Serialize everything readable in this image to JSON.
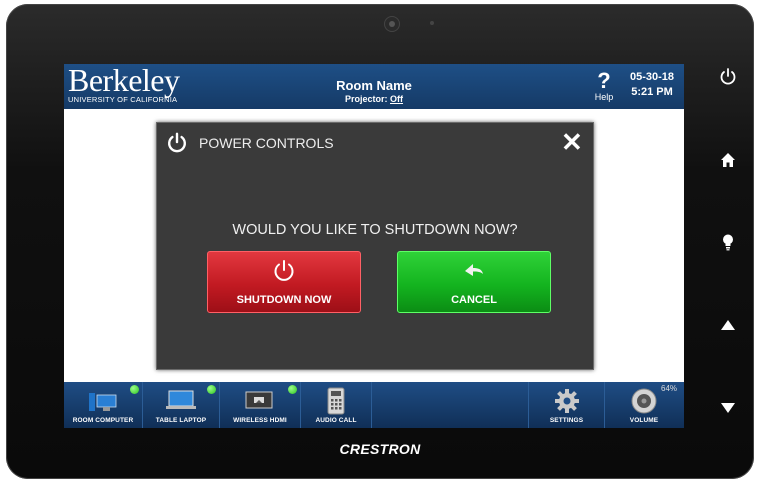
{
  "header": {
    "logo_main": "Berkeley",
    "logo_sub": "UNIVERSITY OF CALIFORNIA",
    "room_name": "Room Name",
    "projector_label": "Projector:",
    "projector_state": "Off",
    "help_glyph": "?",
    "help_label": "Help",
    "date": "05-30-18",
    "time": "5:21 PM"
  },
  "dialog": {
    "title": "POWER CONTROLS",
    "close_glyph": "✕",
    "question": "WOULD YOU LIKE TO SHUTDOWN NOW?",
    "shutdown_label": "SHUTDOWN NOW",
    "cancel_label": "CANCEL"
  },
  "sources": [
    {
      "label": "ROOM COMPUTER",
      "icon": "desktop-computer-icon",
      "active": true
    },
    {
      "label": "TABLE LAPTOP",
      "icon": "laptop-icon",
      "active": true
    },
    {
      "label": "WIRELESS HDMI",
      "icon": "wireless-display-icon",
      "active": true
    },
    {
      "label": "AUDIO CALL",
      "icon": "phone-icon",
      "active": false
    }
  ],
  "settings_label": "SETTINGS",
  "volume": {
    "label": "VOLUME",
    "percent_text": "64%"
  },
  "brand": "CRESTRON",
  "side_buttons": [
    "power-icon",
    "home-icon",
    "lightbulb-icon",
    "up-arrow-icon",
    "down-arrow-icon"
  ],
  "colors": {
    "header_blue": "#1e4f86",
    "shutdown_red": "#c21a22",
    "cancel_green": "#14b41f",
    "status_green": "#2bc21e"
  }
}
